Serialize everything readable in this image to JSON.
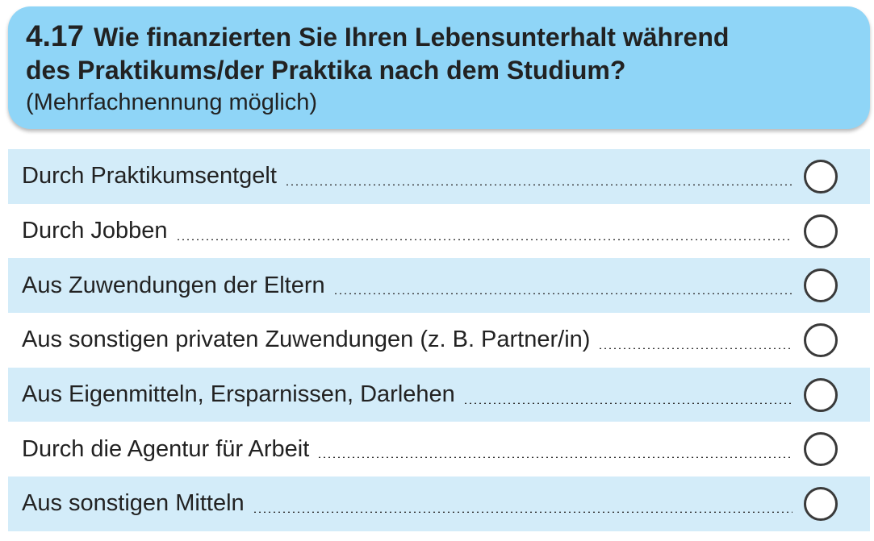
{
  "question": {
    "number": "4.17",
    "title_line1": "Wie finanzierten Sie Ihren Lebensunterhalt während",
    "title_line2": "des Praktikums/der Praktika nach dem Studium?",
    "hint": "(Mehrfachnennung möglich)"
  },
  "options": [
    {
      "label": "Durch Praktikumsentgelt",
      "selected": false
    },
    {
      "label": "Durch Jobben",
      "selected": false
    },
    {
      "label": "Aus Zuwendungen der Eltern",
      "selected": false
    },
    {
      "label": "Aus sonstigen privaten Zuwendungen (z. B. Partner/in)",
      "selected": false
    },
    {
      "label": "Aus Eigenmitteln, Ersparnissen, Darlehen",
      "selected": false
    },
    {
      "label": "Durch die Agentur für Arbeit",
      "selected": false
    },
    {
      "label": "Aus sonstigen Mitteln",
      "selected": false
    }
  ],
  "colors": {
    "header_background": "#8fd5f7",
    "row_shade": "#d3ecf9"
  }
}
